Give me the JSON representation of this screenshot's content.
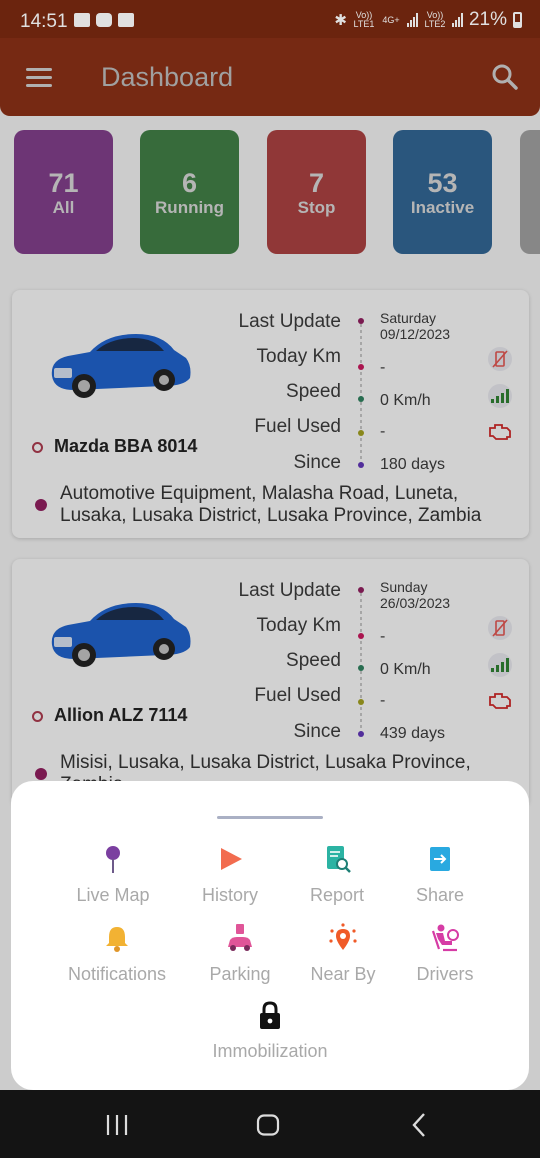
{
  "status_bar": {
    "time": "14:51",
    "carrier1_label": "Vo)) LTE1",
    "network_type": "4G+",
    "carrier2_label": "Vo)) LTE2",
    "battery": "21%"
  },
  "app_bar": {
    "title": "Dashboard"
  },
  "stats": [
    {
      "count": "71",
      "label": "All",
      "color": "#7d3d86"
    },
    {
      "count": "6",
      "label": "Running",
      "color": "#3f7a44"
    },
    {
      "count": "7",
      "label": "Stop",
      "color": "#a43f3f"
    },
    {
      "count": "53",
      "label": "Inactive",
      "color": "#30628f"
    }
  ],
  "vehicles": [
    {
      "name": "Mazda BBA 8014",
      "labels": {
        "last_update": "Last Update",
        "today_km": "Today Km",
        "speed": "Speed",
        "fuel_used": "Fuel Used",
        "since": "Since"
      },
      "last_update_day": "Saturday",
      "last_update_date": "09/12/2023",
      "today_km": "-",
      "speed": "0 Km/h",
      "fuel_used": "-",
      "since": "180 days",
      "address": "Automotive Equipment, Malasha Road, Luneta, Lusaka, Lusaka District, Lusaka Province, Zambia"
    },
    {
      "name": "Allion ALZ 7114",
      "labels": {
        "last_update": "Last Update",
        "today_km": "Today Km",
        "speed": "Speed",
        "fuel_used": "Fuel Used",
        "since": "Since"
      },
      "last_update_day": "Sunday",
      "last_update_date": "26/03/2023",
      "today_km": "-",
      "speed": "0 Km/h",
      "fuel_used": "-",
      "since": "439 days",
      "address": "Misisi, Lusaka, Lusaka District, Lusaka Province, Zambia"
    }
  ],
  "sheet": {
    "actions": [
      {
        "label": "Live Map",
        "icon": "map-pin-icon"
      },
      {
        "label": "History",
        "icon": "play-icon"
      },
      {
        "label": "Report",
        "icon": "report-icon"
      },
      {
        "label": "Share",
        "icon": "share-icon"
      },
      {
        "label": "Notifications",
        "icon": "bell-icon"
      },
      {
        "label": "Parking",
        "icon": "parking-icon"
      },
      {
        "label": "Near By",
        "icon": "near-by-icon"
      },
      {
        "label": "Drivers",
        "icon": "driver-icon"
      },
      {
        "label": "Immobilization",
        "icon": "lock-icon"
      }
    ]
  },
  "colors": {
    "app_bar": "#872f16",
    "timeline_magenta": "#8b1e5c",
    "timeline_green": "#2e7d5c",
    "timeline_olive": "#9c9a1f",
    "timeline_purple": "#5e35b1"
  }
}
